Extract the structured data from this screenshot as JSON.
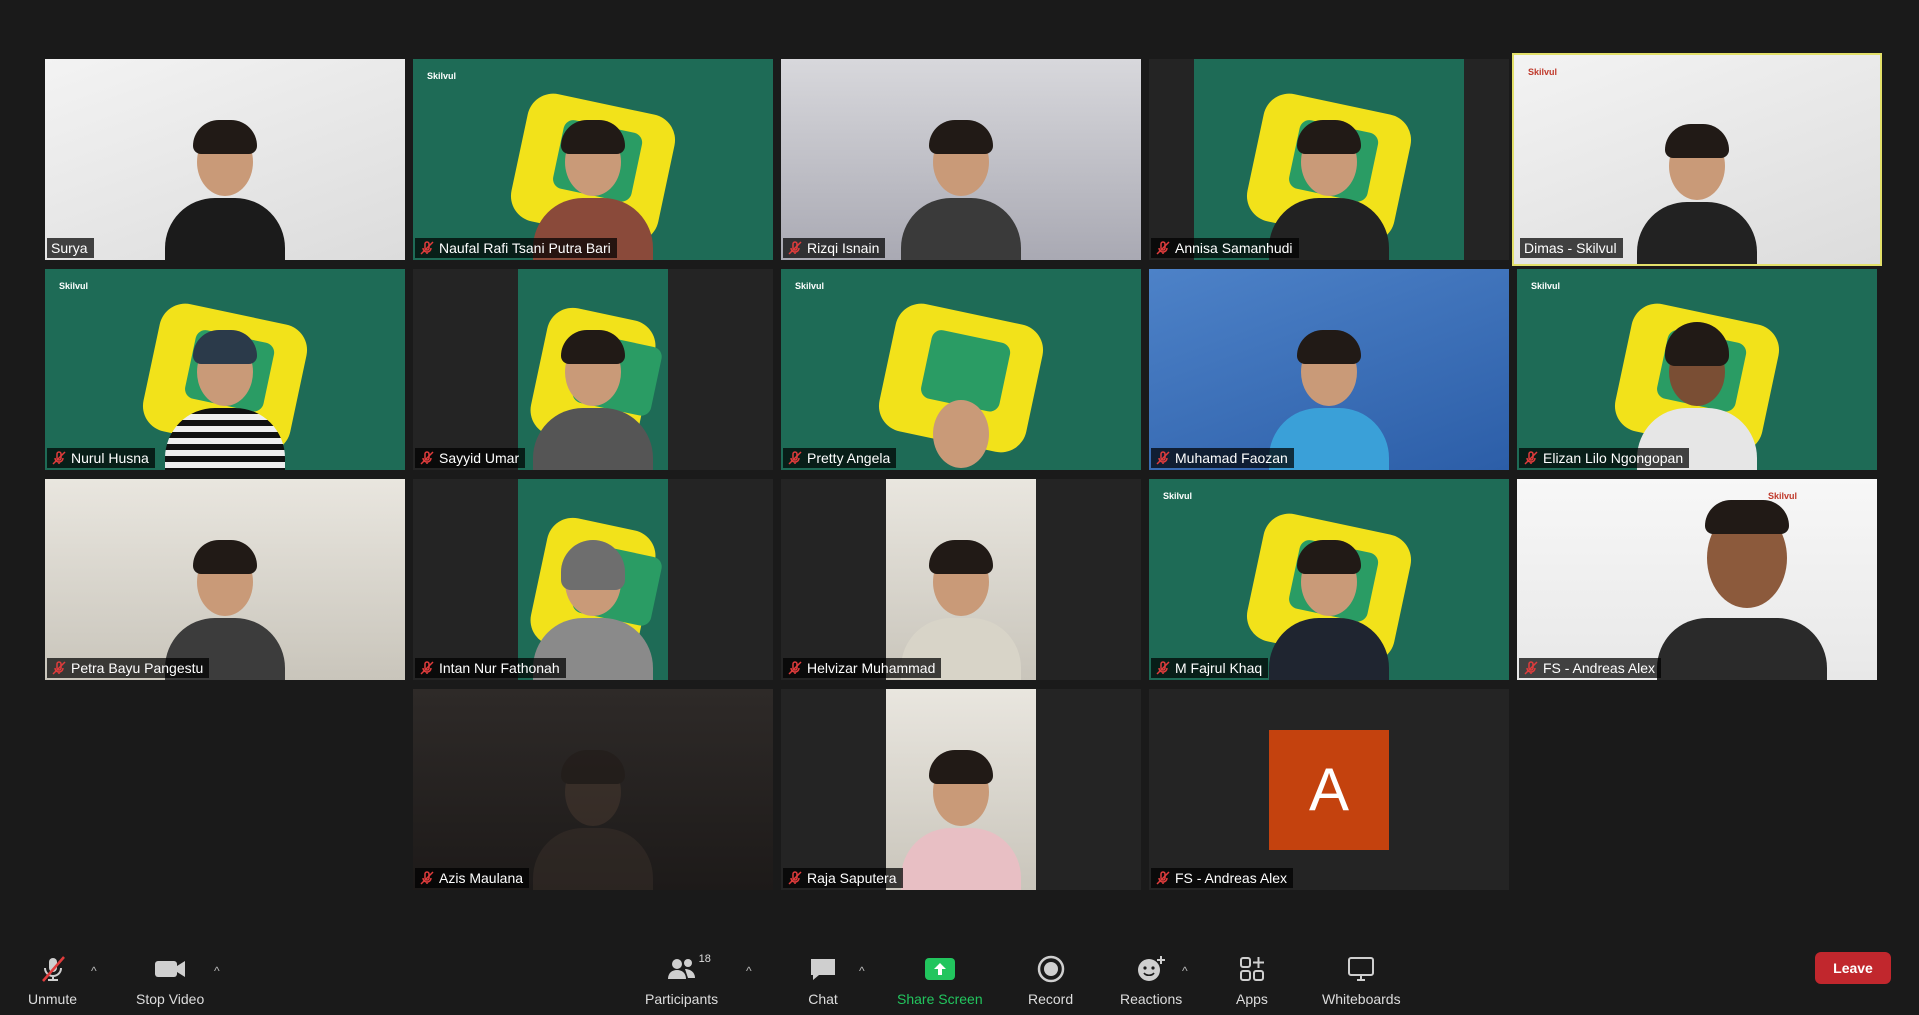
{
  "participants": [
    {
      "name": "Surya",
      "muted": false,
      "active": false
    },
    {
      "name": "Naufal Rafi Tsani Putra Bari",
      "muted": true,
      "active": false
    },
    {
      "name": "Rizqi Isnain",
      "muted": true,
      "active": false
    },
    {
      "name": "Annisa Samanhudi",
      "muted": true,
      "active": false
    },
    {
      "name": "Dimas - Skilvul",
      "muted": false,
      "active": true
    },
    {
      "name": "Nurul Husna",
      "muted": true,
      "active": false
    },
    {
      "name": "Sayyid Umar",
      "muted": true,
      "active": false
    },
    {
      "name": "Pretty Angela",
      "muted": true,
      "active": false
    },
    {
      "name": "Muhamad Faozan",
      "muted": true,
      "active": false
    },
    {
      "name": "Elizan Lilo Ngongopan",
      "muted": true,
      "active": false
    },
    {
      "name": "Petra Bayu Pangestu",
      "muted": true,
      "active": false
    },
    {
      "name": "Intan Nur Fathonah",
      "muted": true,
      "active": false
    },
    {
      "name": "Helvizar Muhammad",
      "muted": true,
      "active": false
    },
    {
      "name": "M Fajrul Khaq",
      "muted": true,
      "active": false
    },
    {
      "name": "FS - Andreas Alex",
      "muted": true,
      "active": false
    },
    {
      "name": "Azis Maulana",
      "muted": true,
      "active": false
    },
    {
      "name": "Raja Saputera",
      "muted": true,
      "active": false
    },
    {
      "name": "FS - Andreas Alex",
      "muted": true,
      "active": false,
      "avatar_letter": "A"
    }
  ],
  "branding": {
    "skilvul": "Skilvul"
  },
  "toolbar": {
    "unmute": "Unmute",
    "stop_video": "Stop Video",
    "participants": "Participants",
    "participants_count": "18",
    "chat": "Chat",
    "share_screen": "Share Screen",
    "record": "Record",
    "reactions": "Reactions",
    "apps": "Apps",
    "whiteboards": "Whiteboards",
    "leave": "Leave"
  },
  "colors": {
    "background": "#1a1a1a",
    "active_speaker": "#e3e06a",
    "share_green": "#22c55e",
    "leave_red": "#c1272d",
    "avatar": "#c4420e",
    "skilvul_green": "#1e6b56",
    "skilvul_yellow": "#f2e21a"
  }
}
